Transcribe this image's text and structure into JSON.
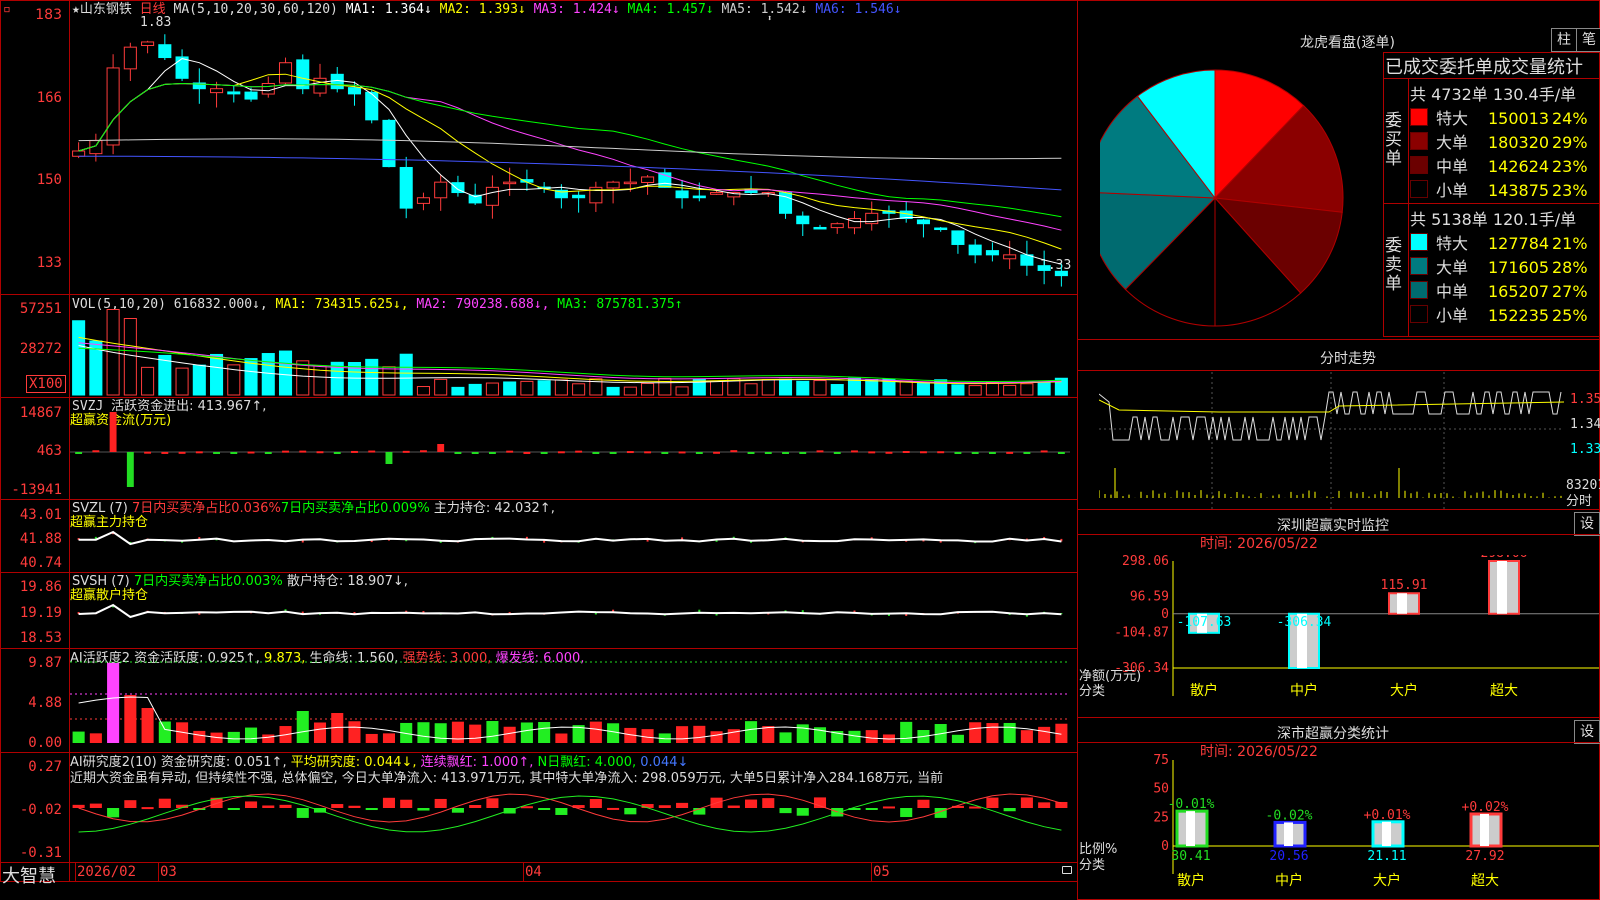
{
  "main": {
    "star": "★",
    "stock": "山东钢铁",
    "period": "日线",
    "ma_label": "MA(5,10,20,30,60,120)",
    "ma": [
      {
        "name": "MA1:",
        "value": "1.364↓",
        "color": "#ffffff"
      },
      {
        "name": "MA2:",
        "value": "1.393↓",
        "color": "#ffff00"
      },
      {
        "name": "MA3:",
        "value": "1.424↓",
        "color": "#ff44ff"
      },
      {
        "name": "MA4:",
        "value": "1.457↓",
        "color": "#00ff00"
      },
      {
        "name": "MA5:",
        "value": "1.542↓",
        "color": "#cccccc"
      },
      {
        "name": "MA6:",
        "value": "1.546↓",
        "color": "#4455ff"
      }
    ],
    "y_ticks": [
      "183",
      "166",
      "150",
      "133"
    ],
    "high_label": "1.83",
    "low_label": "1.33"
  },
  "vol": {
    "label": "VOL(5,10,20)",
    "value": "616832.000↓,",
    "ma1": "MA1: 734315.625↓,",
    "ma2": "MA2: 790238.688↓,",
    "ma3": "MA3: 875781.375↑",
    "y_ticks": [
      "57251",
      "28272"
    ],
    "unit": "X100"
  },
  "svzj": {
    "label": "SVZJ",
    "desc": "活跃资金进出: 413.967↑,",
    "sub": "超赢资金流(万元)",
    "y_ticks": [
      "14867",
      "463",
      "-13941"
    ]
  },
  "svzl": {
    "label": "SVZL (7)",
    "d1": "7日内买卖净占比0.036%",
    "d2": "7日内买卖净占比0.009%",
    "d3": "主力持仓: 42.032↑,",
    "sub": "超赢主力持仓",
    "y_ticks": [
      "43.01",
      "41.88",
      "40.74"
    ]
  },
  "svsh": {
    "label": "SVSH (7)",
    "d1": "7日内买卖净占比0.003%",
    "d2": "散户持仓: 18.907↓,",
    "sub": "超赢散户持仓",
    "y_ticks": [
      "19.86",
      "19.19",
      "18.53"
    ]
  },
  "ai1": {
    "label": "AI活跃度2",
    "d1": "资金活跃度: 0.925↑,",
    "d2": "9.873,",
    "d3": "生命线: 1.560,",
    "d4": "强势线: 3.000,",
    "d5": "爆发线: 6.000,",
    "y_ticks": [
      "9.87",
      "4.88",
      "0.00"
    ]
  },
  "ai2": {
    "label": "AI研究度2(10)",
    "d1": "资金研究度: 0.051↑,",
    "d2": "平均研究度: 0.044↓,",
    "d3": "连续飘红: 1.000↑,",
    "d4": "N日飘红: 4.000,",
    "d5": "0.044↓",
    "comment": "近期大资金虽有异动, 但持续性不强, 总体偏空, 今日大单净流入: 413.971万元, 其中特大单净流入: 298.059万元, 大单5日累计净入284.168万元, 当前",
    "y_ticks": [
      "0.27",
      "-0.02",
      "-0.31"
    ]
  },
  "bottom": {
    "brand": "大智慧",
    "dates": [
      "2026/02",
      "03",
      "04",
      "05"
    ]
  },
  "dragon": {
    "title": "龙虎看盘(逐单)",
    "btn1": "柱",
    "btn2": "笔",
    "header": "已成交委托单成交量统计",
    "buy_total": "共 4732单 130.4手/单",
    "buy_side": "委买单",
    "buy_rows": [
      {
        "label": "特大",
        "value": "150013",
        "pct": "24%",
        "color": "#ff0000"
      },
      {
        "label": "大单",
        "value": "180320",
        "pct": "29%",
        "color": "#8b0000"
      },
      {
        "label": "中单",
        "value": "142624",
        "pct": "23%",
        "color": "#6b0000"
      },
      {
        "label": "小单",
        "value": "143875",
        "pct": "23%",
        "color": "#000000"
      }
    ],
    "sell_total": "共 5138单 120.1手/单",
    "sell_side": "委卖单",
    "sell_rows": [
      {
        "label": "特大",
        "value": "127784",
        "pct": "21%",
        "color": "#00ffff"
      },
      {
        "label": "大单",
        "value": "171605",
        "pct": "28%",
        "color": "#007b80"
      },
      {
        "label": "中单",
        "value": "165207",
        "pct": "27%",
        "color": "#006b70"
      },
      {
        "label": "小单",
        "value": "152235",
        "pct": "25%",
        "color": "#000000"
      }
    ]
  },
  "fenshi": {
    "title": "分时走势",
    "y_ticks": [
      "1.350",
      "1.340",
      "1.330"
    ],
    "vol_label": "83201",
    "vol_unit": "分时"
  },
  "monitor": {
    "title": "深圳超赢实时监控",
    "btn": "设",
    "time": "时间: 2026/05/22",
    "y_ticks": [
      "298.06",
      "96.59",
      "0",
      "-104.87",
      "-306.34"
    ],
    "ylabel": "净额(万元)",
    "xlabel": "分类",
    "bars": [
      {
        "label": "散户",
        "value": "-107.63"
      },
      {
        "label": "中户",
        "value": "-306.34"
      },
      {
        "label": "大户",
        "value": "115.91"
      },
      {
        "label": "超大",
        "value": "298.06"
      }
    ]
  },
  "classify": {
    "title": "深市超赢分类统计",
    "btn": "设",
    "time": "时间: 2026/05/22",
    "y_ticks": [
      "75",
      "50",
      "25",
      "0"
    ],
    "ylabel": "比例%",
    "xlabel": "分类",
    "bars": [
      {
        "label": "散户",
        "value": "30.41",
        "change": "-0.01%"
      },
      {
        "label": "中户",
        "value": "20.56",
        "change": "-0.02%"
      },
      {
        "label": "大户",
        "value": "21.11",
        "change": "+0.01%"
      },
      {
        "label": "超大",
        "value": "27.92",
        "change": "+0.02%"
      }
    ]
  },
  "chart_data": {
    "type": "pie",
    "title": "龙虎看盘(逐单)",
    "categories": [
      "委买特大",
      "委买大单",
      "委买中单",
      "委买小单",
      "委卖特大",
      "委卖大单",
      "委卖中单",
      "委卖小单"
    ],
    "values": [
      150013,
      180320,
      142624,
      143875,
      127784,
      171605,
      165207,
      152235
    ]
  }
}
